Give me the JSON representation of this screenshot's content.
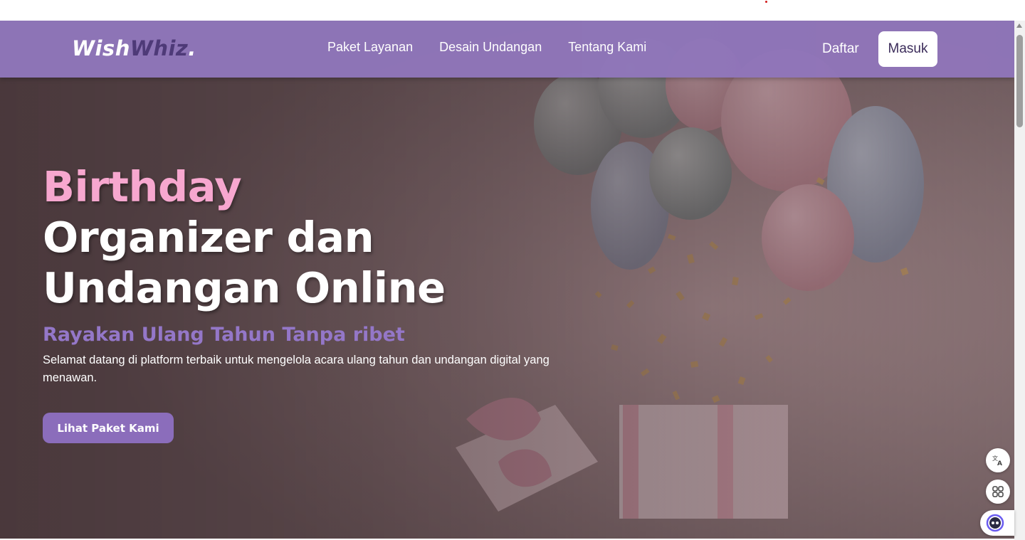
{
  "navbar": {
    "logo": {
      "part1": "Wish",
      "part2": "Whiz",
      "part3": "."
    },
    "links": [
      "Paket Layanan",
      "Desain Undangan",
      "Tentang Kami"
    ],
    "daftar_label": "Daftar",
    "masuk_label": "Masuk"
  },
  "hero": {
    "headline_line1": "Birthday",
    "headline_line2": "Organizer dan",
    "headline_line3": "Undangan Online",
    "subheadline": "Rayakan Ulang Tahun Tanpa ribet",
    "description": "Selamat datang di platform terbaik untuk mengelola acara ulang tahun dan undangan digital yang menawan.",
    "cta_label": "Lihat Paket Kami"
  },
  "colors": {
    "navbar_bg": "#8f76ba",
    "accent_purple": "#8b6dbb",
    "headline_pink": "#f7a7cf",
    "subheadline_purple": "#9477c8",
    "logo_dark": "#4e3a78"
  },
  "widgets": {
    "icons": [
      "translate-icon",
      "apps-grid-icon",
      "assistant-icon"
    ]
  }
}
